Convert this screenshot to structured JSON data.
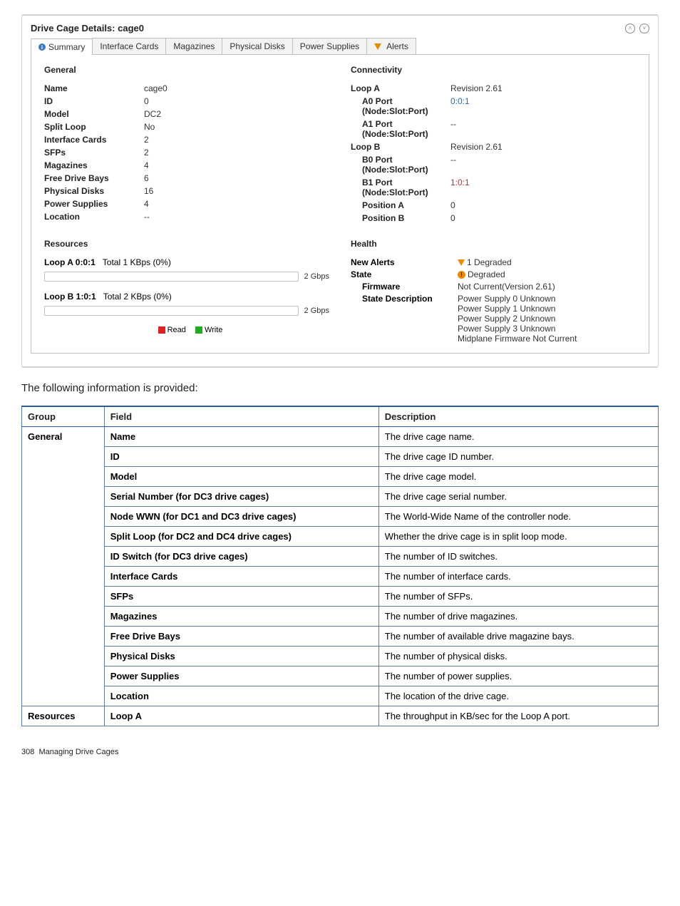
{
  "panel": {
    "title": "Drive Cage Details: cage0"
  },
  "tabs": [
    {
      "label": "Summary",
      "icon": "info",
      "active": true
    },
    {
      "label": "Interface Cards"
    },
    {
      "label": "Magazines"
    },
    {
      "label": "Physical Disks"
    },
    {
      "label": "Power Supplies"
    },
    {
      "label": "Alerts",
      "icon": "alert"
    }
  ],
  "general": {
    "heading": "General",
    "rows": [
      {
        "k": "Name",
        "v": "cage0"
      },
      {
        "k": "ID",
        "v": "0"
      },
      {
        "k": "Model",
        "v": "DC2"
      },
      {
        "k": "Split Loop",
        "v": "No"
      },
      {
        "k": "Interface Cards",
        "v": "2"
      },
      {
        "k": "SFPs",
        "v": "2"
      },
      {
        "k": "Magazines",
        "v": "4"
      },
      {
        "k": "Free Drive Bays",
        "v": "6"
      },
      {
        "k": "Physical Disks",
        "v": "16"
      },
      {
        "k": "Power Supplies",
        "v": "4"
      },
      {
        "k": "Location",
        "v": "--"
      }
    ]
  },
  "connectivity": {
    "heading": "Connectivity",
    "loopA": {
      "label": "Loop A",
      "rev": "Revision 2.61",
      "a0": {
        "k": "A0 Port (Node:Slot:Port)",
        "v": "0:0:1",
        "cls": "link-blue"
      },
      "a1": {
        "k": "A1 Port (Node:Slot:Port)",
        "v": "--"
      }
    },
    "loopB": {
      "label": "Loop B",
      "rev": "Revision 2.61",
      "b0": {
        "k": "B0 Port (Node:Slot:Port)",
        "v": "--"
      },
      "b1": {
        "k": "B1 Port (Node:Slot:Port)",
        "v": "1:0:1",
        "cls": "link-red"
      }
    },
    "posA": {
      "k": "Position A",
      "v": "0"
    },
    "posB": {
      "k": "Position B",
      "v": "0"
    }
  },
  "resources": {
    "heading": "Resources",
    "loopA": {
      "title": "Loop A 0:0:1",
      "text": "Total 1 KBps (0%)",
      "cap": "2 Gbps"
    },
    "loopB": {
      "title": "Loop B 1:0:1",
      "text": "Total 2 KBps (0%)",
      "cap": "2 Gbps"
    },
    "legend": {
      "read": "Read",
      "write": "Write"
    }
  },
  "health": {
    "heading": "Health",
    "newAlerts": {
      "k": "New Alerts",
      "v": "1 Degraded"
    },
    "state": {
      "k": "State",
      "v": "Degraded"
    },
    "firmware": {
      "k": "Firmware",
      "v": "Not Current(Version 2.61)"
    },
    "stateDesc": {
      "k": "State Description",
      "lines": [
        "Power Supply 0 Unknown",
        "Power Supply 1 Unknown",
        "Power Supply 2 Unknown",
        "Power Supply 3 Unknown",
        "Midplane Firmware Not Current"
      ]
    }
  },
  "bodyText": "The following information is provided:",
  "table": {
    "headers": {
      "group": "Group",
      "field": "Field",
      "desc": "Description"
    },
    "rows": [
      {
        "group": "General",
        "field": "Name",
        "desc": "The drive cage name."
      },
      {
        "field": "ID",
        "desc": "The drive cage ID number."
      },
      {
        "field": "Model",
        "desc": "The drive cage model."
      },
      {
        "field": "Serial Number (for DC3 drive cages)",
        "desc": "The drive cage serial number."
      },
      {
        "field_html": "<b>Node WWN</b> (for DC1 and DC3 drive cages)",
        "desc": "The World-Wide Name of the controller node."
      },
      {
        "field_html": "<b>Split Loop</b> (for DC2 and DC4 drive cages)",
        "desc": "Whether the drive cage is in split loop mode."
      },
      {
        "field_html": "<b>ID Switch</b> (for DC3 drive cages)",
        "desc": "The number of ID switches."
      },
      {
        "field": "Interface Cards",
        "desc": "The number of interface cards."
      },
      {
        "field": "SFPs",
        "desc": "The number of SFPs."
      },
      {
        "field": "Magazines",
        "desc": "The number of drive magazines."
      },
      {
        "field": "Free Drive Bays",
        "desc": "The number of available drive magazine bays."
      },
      {
        "field": "Physical Disks",
        "desc": "The number of physical disks."
      },
      {
        "field": "Power Supplies",
        "desc": "The number of power supplies."
      },
      {
        "field": "Location",
        "desc": "The location of the drive cage."
      },
      {
        "group": "Resources",
        "field": "Loop A",
        "desc": "The throughput in KB/sec for the Loop A port."
      }
    ]
  },
  "footer": {
    "page": "308",
    "title": "Managing Drive Cages"
  }
}
